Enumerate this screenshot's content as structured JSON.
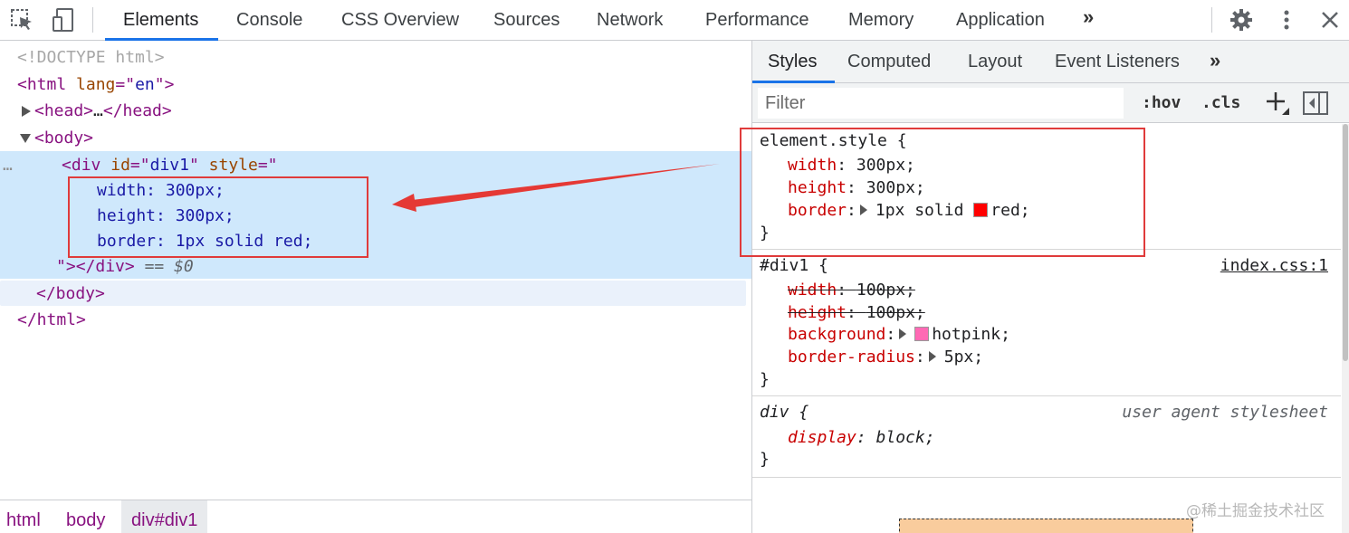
{
  "toolbar": {
    "icons": [
      "inspect-element-icon",
      "device-toolbar-icon",
      "settings-gear-icon",
      "more-menu-icon",
      "close-icon"
    ],
    "tabs": [
      "Elements",
      "Console",
      "CSS Overview",
      "Sources",
      "Network",
      "Performance",
      "Memory",
      "Application"
    ],
    "active_tab": "Elements",
    "overflow": "»"
  },
  "dom": {
    "doctype": "<!DOCTYPE html>",
    "html_open": {
      "tag": "html",
      "attr": "lang",
      "value": "en"
    },
    "head_collapsed": {
      "open": "<head>",
      "ellipsis": "…",
      "close": "</head>"
    },
    "body_open": "<body>",
    "div_open": {
      "tag": "div",
      "id_attr": "id",
      "id_value": "div1",
      "style_attr": "style"
    },
    "style_lines": [
      "width: 300px;",
      "height: 300px;",
      "border: 1px solid red;"
    ],
    "div_close": {
      "quote": "\">",
      "tag": "</div>",
      "eq": "== $0"
    },
    "body_close": "</body>",
    "html_close": "</html>",
    "gutter_dots": "…"
  },
  "breadcrumbs": [
    "html",
    "body",
    "div#div1"
  ],
  "styles_panel": {
    "subtabs": [
      "Styles",
      "Computed",
      "Layout",
      "Event Listeners"
    ],
    "active_subtab": "Styles",
    "overflow": "»",
    "filter_placeholder": "Filter",
    "hov": ":hov",
    "cls": ".cls",
    "rules": [
      {
        "selector": "element.style {",
        "props": [
          {
            "name": "width",
            "value": "300px;"
          },
          {
            "name": "height",
            "value": "300px;"
          },
          {
            "name": "border",
            "value_pre": "1px solid",
            "swatch": "#ff0000",
            "value_post": "red;"
          }
        ],
        "close": "}"
      },
      {
        "selector": "#div1 {",
        "source": "index.css:1",
        "props": [
          {
            "name": "width",
            "value": "100px;",
            "overridden": true
          },
          {
            "name": "height",
            "value": "100px;",
            "overridden": true
          },
          {
            "name": "background",
            "swatch": "#ff69b4",
            "value_post": "hotpink;"
          },
          {
            "name": "border-radius",
            "value_post": "5px;"
          }
        ],
        "close": "}"
      },
      {
        "selector": "div {",
        "source": "user agent stylesheet",
        "props": [
          {
            "name": "display",
            "value": "block;"
          }
        ],
        "close": "}"
      }
    ]
  },
  "watermark": "@稀土掘金技术社区",
  "colors": {
    "highlight_box": "#e03b3b",
    "selection_bg": "#cfe8fc",
    "active_tab_underline": "#1a73e8",
    "margin_box": "#f9cc9d"
  }
}
